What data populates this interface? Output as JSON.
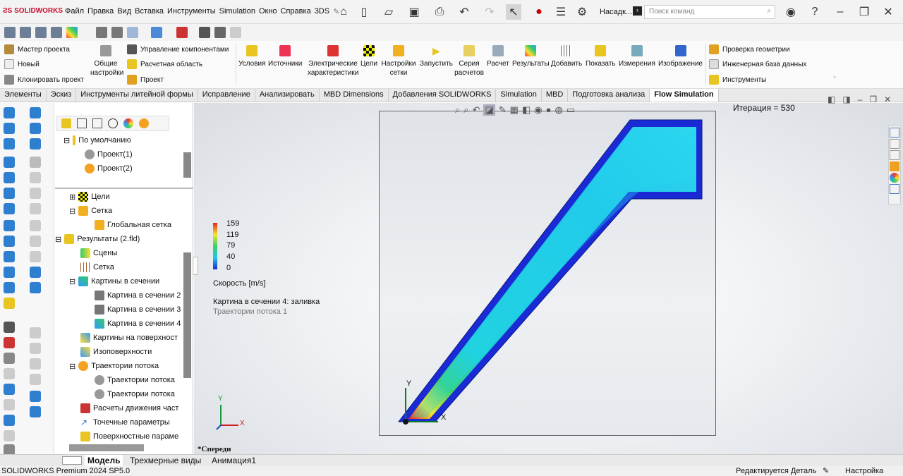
{
  "app": {
    "logo": "SOLIDWORKS"
  },
  "menu": [
    "Файл",
    "Правка",
    "Вид",
    "Вставка",
    "Инструменты",
    "Simulation",
    "Окно",
    "Справка",
    "3DS"
  ],
  "quick_access": {
    "view_label": "Насадк...",
    "search_placeholder": "Поиск команд"
  },
  "command_manager": {
    "left": [
      "Мастер проекта",
      "Новый",
      "Клонировать проект"
    ],
    "general_settings": "Общие настройки",
    "middle": [
      "Управление компонентами",
      "Расчетная область",
      "Проект"
    ],
    "buttons": [
      "Условия",
      "Источники",
      "Электрические характеристики",
      "Цели",
      "Настройки сетки",
      "Запустить",
      "Серия расчетов",
      "Расчет",
      "Результаты",
      "Добавить",
      "Показать",
      "Измерения",
      "Изображение"
    ],
    "right": [
      "Проверка геометрии",
      "Инженерная база данных",
      "Инструменты"
    ]
  },
  "tabs": [
    "Элементы",
    "Эскиз",
    "Инструменты литейной формы",
    "Исправление",
    "Анализировать",
    "MBD Dimensions",
    "Добавления SOLIDWORKS",
    "Simulation",
    "MBD",
    "Подготовка анализа",
    "Flow Simulation"
  ],
  "active_tab": "Flow Simulation",
  "tree": {
    "default": "По умолчанию",
    "project1": "Проект(1)",
    "project2": "Проект(2)",
    "goals": "Цели",
    "mesh": "Сетка",
    "global_mesh": "Глобальная сетка",
    "results": "Результаты (2.fld)",
    "scenes": "Сцены",
    "mesh2": "Сетка",
    "cut_plots": "Картины в сечении",
    "cut1": "Картина в сечении 2",
    "cut2": "Картина в сечении 3",
    "cut3": "Картина в сечении 4",
    "surface_plots": "Картины на поверхност",
    "isosurfaces": "Изоповерхности",
    "flow_traj": "Траектории потока",
    "traj1": "Траектории потока",
    "traj2": "Траектории потока",
    "particles": "Расчеты движения част",
    "point_params": "Точечные параметры",
    "surface_params": "Поверхностные параме"
  },
  "viewport": {
    "iteration": "Итерация = 530",
    "legend": {
      "ticks": [
        "159",
        "119",
        "79",
        "40",
        "0"
      ],
      "quantity": "Скорость [m/s]",
      "colors": [
        "#e8201e",
        "#f5e52a",
        "#3bd16a",
        "#20c6e8",
        "#1a2bd6"
      ]
    },
    "plot_title": "Картина в сечении 4: заливка",
    "plot_subtitle": "Траектории потока 1",
    "view_name": "*Спереди",
    "axes": {
      "x": "X",
      "y": "Y"
    }
  },
  "bottom_tabs": [
    "Модель",
    "Трехмерные виды",
    "Анимация1"
  ],
  "status": {
    "left": "SOLIDWORKS Premium 2024 SP5.0",
    "editing": "Редактируется Деталь",
    "custom": "Настройка"
  }
}
